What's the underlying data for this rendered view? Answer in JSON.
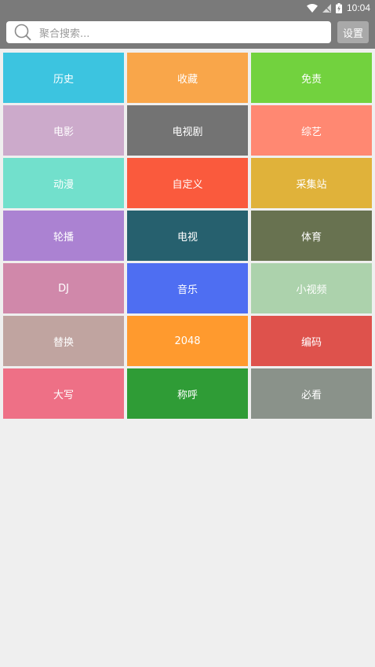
{
  "status": {
    "time": "10:04"
  },
  "search": {
    "placeholder": "聚合搜索..."
  },
  "settings": {
    "label": "设置"
  },
  "tiles": [
    {
      "label": "历史",
      "color": "#3cc4e0"
    },
    {
      "label": "收藏",
      "color": "#f9a64a"
    },
    {
      "label": "免责",
      "color": "#72d23e"
    },
    {
      "label": "电影",
      "color": "#ccaacb"
    },
    {
      "label": "电视剧",
      "color": "#737373"
    },
    {
      "label": "综艺",
      "color": "#ff8872"
    },
    {
      "label": "动漫",
      "color": "#72e0cc"
    },
    {
      "label": "自定义",
      "color": "#fa5a3d"
    },
    {
      "label": "采集站",
      "color": "#e0b23a"
    },
    {
      "label": "轮播",
      "color": "#ab82d2"
    },
    {
      "label": "电视",
      "color": "#26606e"
    },
    {
      "label": "体育",
      "color": "#687250"
    },
    {
      "label": "DJ",
      "color": "#d088aa"
    },
    {
      "label": "音乐",
      "color": "#4e6ef2"
    },
    {
      "label": "小视频",
      "color": "#acd2ac"
    },
    {
      "label": "替换",
      "color": "#c0a4a0"
    },
    {
      "label": "2048",
      "color": "#ff9a2e"
    },
    {
      "label": "编码",
      "color": "#de524c"
    },
    {
      "label": "大写",
      "color": "#ee7086"
    },
    {
      "label": "称呼",
      "color": "#2f9c36"
    },
    {
      "label": "必看",
      "color": "#8a928a"
    }
  ]
}
